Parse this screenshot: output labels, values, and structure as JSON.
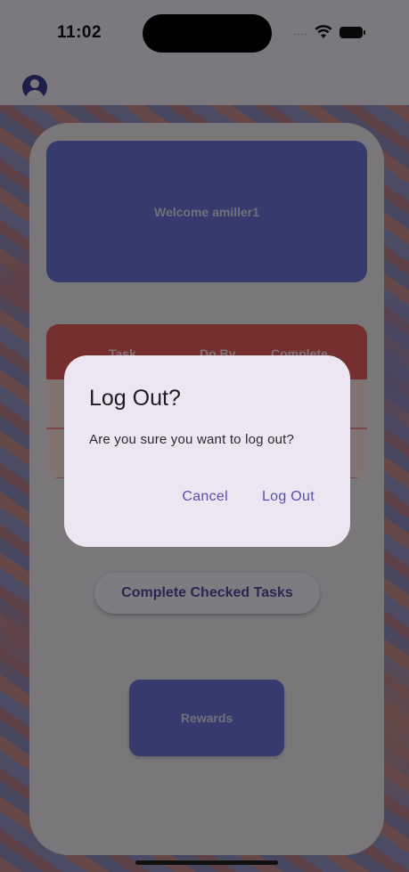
{
  "status_bar": {
    "time": "11:02",
    "signal_dots": "....",
    "wifi_icon": "wifi-icon",
    "battery_icon": "battery-icon"
  },
  "app_bar": {
    "profile_icon": "account-circle-icon"
  },
  "home": {
    "welcome_text": "Welcome amiller1",
    "task_table": {
      "headers": [
        "Task",
        "Do By",
        "Complete"
      ],
      "rows": [
        [],
        []
      ]
    },
    "complete_button_label": "Complete Checked Tasks",
    "rewards_button_label": "Rewards"
  },
  "dialog": {
    "title": "Log Out?",
    "message": "Are you sure you want to log out?",
    "cancel_label": "Cancel",
    "confirm_label": "Log Out"
  },
  "colors": {
    "primary": "#6a6fd1",
    "accent_red": "#e35b5b",
    "dialog_action": "#5b4fa6"
  }
}
